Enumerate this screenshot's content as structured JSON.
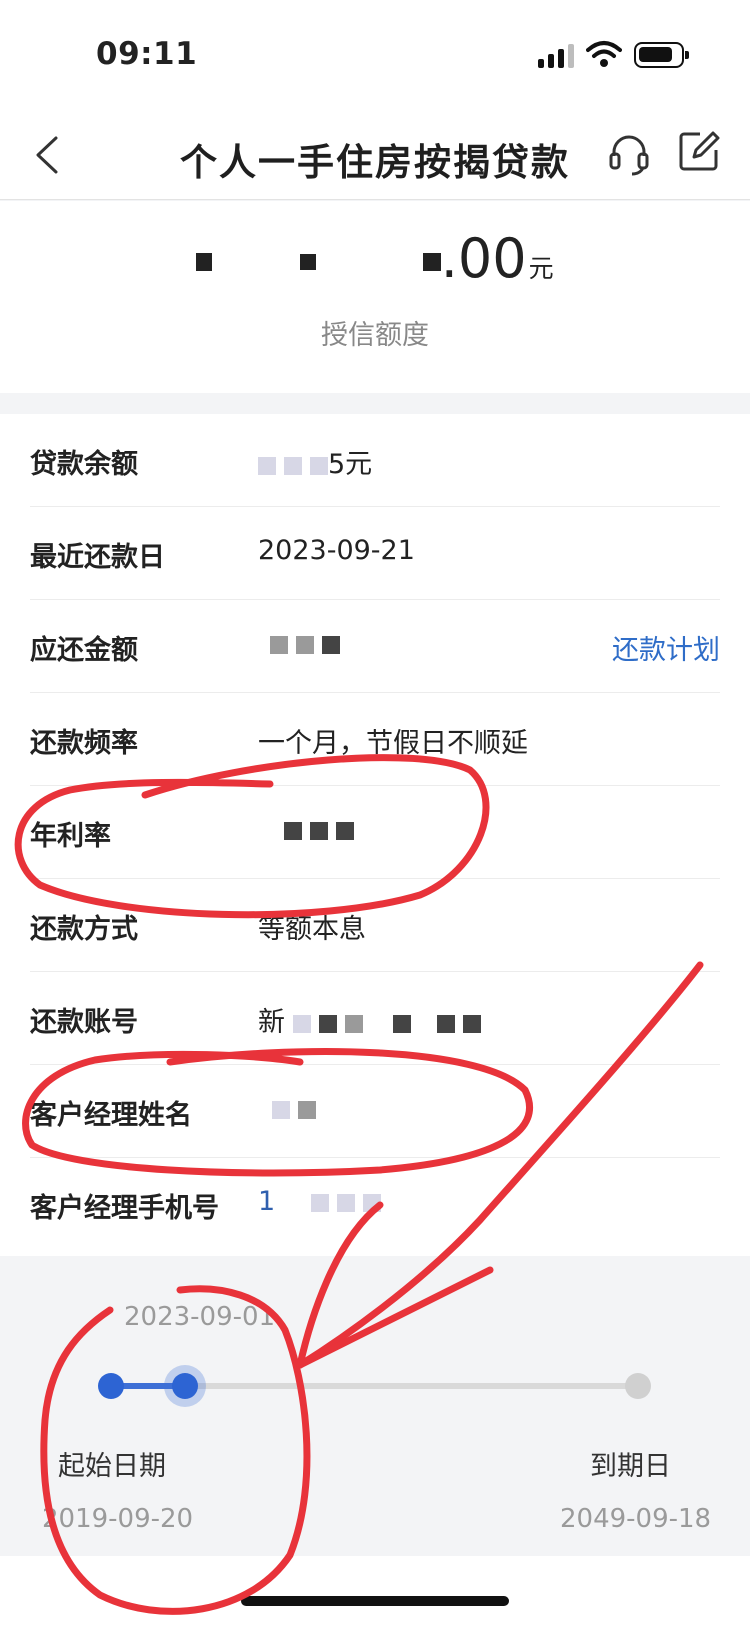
{
  "status_bar": {
    "time": "09:11"
  },
  "nav": {
    "title": "个人一手住房按揭贷款"
  },
  "credit": {
    "amount_visible": ".00",
    "unit": "元",
    "label": "授信额度"
  },
  "rows": [
    {
      "label": "贷款余额",
      "value": "5元"
    },
    {
      "label": "最近还款日",
      "value": "2023-09-21"
    },
    {
      "label": "应还金额",
      "value": "",
      "action": "还款计划"
    },
    {
      "label": "还款频率",
      "value": "一个月，节假日不顺延"
    },
    {
      "label": "年利率",
      "value": ""
    },
    {
      "label": "还款方式",
      "value": "等额本息"
    },
    {
      "label": "还款账号",
      "value": "新"
    },
    {
      "label": "客户经理姓名",
      "value": ""
    },
    {
      "label": "客户经理手机号",
      "value": "1"
    }
  ],
  "timeline": {
    "current_date": "2023-09-01",
    "start_label": "起始日期",
    "end_label": "到期日",
    "start_date": "2019-09-20",
    "end_date": "2049-09-18"
  },
  "colors": {
    "accent": "#2f6dc8",
    "annotation": "#e8333a"
  },
  "icons": [
    "back-chevron-icon",
    "headset-icon",
    "edit-icon"
  ]
}
